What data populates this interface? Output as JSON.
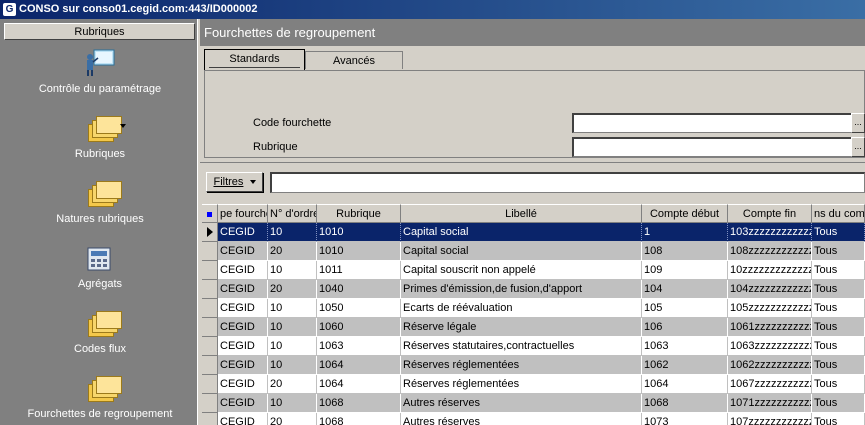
{
  "window": {
    "title": "CONSO sur conso01.cegid.com:443/ID000002",
    "icon": "G"
  },
  "sidebar": {
    "header": "Rubriques",
    "items": [
      {
        "label": "Contrôle du paramétrage",
        "icon": "presentation-board-icon"
      },
      {
        "label": "Rubriques",
        "icon": "folders-icon",
        "has_dropdown": true
      },
      {
        "label": "Natures rubriques",
        "icon": "folders-icon"
      },
      {
        "label": "Agrégats",
        "icon": "calculator-icon"
      },
      {
        "label": "Codes flux",
        "icon": "folders-icon"
      },
      {
        "label": "Fourchettes de regroupement",
        "icon": "folders-icon"
      }
    ]
  },
  "main": {
    "title": "Fourchettes de regroupement",
    "tabs": [
      {
        "label": "Standards",
        "active": true
      },
      {
        "label": "Avancés",
        "active": false
      }
    ],
    "form": {
      "code_label": "Code fourchette",
      "code_value": "",
      "rubrique_label": "Rubrique",
      "rubrique_value": "",
      "ellipsis": "..."
    },
    "filters": {
      "label": "Filtres",
      "value": ""
    },
    "grid": {
      "columns": [
        "pe fourche",
        "N° d'ordre",
        "Rubrique",
        "Libellé",
        "Compte début",
        "Compte fin",
        "ns du com"
      ],
      "rows": [
        [
          "CEGID",
          "10",
          "1010",
          "Capital social",
          "1",
          "103zzzzzzzzzzzzz",
          "Tous"
        ],
        [
          "CEGID",
          "20",
          "1010",
          "Capital social",
          "108",
          "108zzzzzzzzzzzzz",
          "Tous"
        ],
        [
          "CEGID",
          "10",
          "1011",
          "Capital souscrit non appelé",
          "109",
          "10zzzzzzzzzzzzzz",
          "Tous"
        ],
        [
          "CEGID",
          "20",
          "1040",
          "Primes d'émission,de fusion,d'apport",
          "104",
          "104zzzzzzzzzzzzz",
          "Tous"
        ],
        [
          "CEGID",
          "10",
          "1050",
          "Ecarts de réévaluation",
          "105",
          "105zzzzzzzzzzzzz",
          "Tous"
        ],
        [
          "CEGID",
          "10",
          "1060",
          "Réserve légale",
          "106",
          "1061zzzzzzzzzzzz",
          "Tous"
        ],
        [
          "CEGID",
          "10",
          "1063",
          "Réserves statutaires,contractuelles",
          "1063",
          "1063zzzzzzzzzzzz",
          "Tous"
        ],
        [
          "CEGID",
          "10",
          "1064",
          "Réserves réglementées",
          "1062",
          "1062zzzzzzzzzzzz",
          "Tous"
        ],
        [
          "CEGID",
          "20",
          "1064",
          "Réserves réglementées",
          "1064",
          "1067zzzzzzzzzzzz",
          "Tous"
        ],
        [
          "CEGID",
          "10",
          "1068",
          "Autres réserves",
          "1068",
          "1071zzzzzzzzzzzz",
          "Tous"
        ],
        [
          "CEGID",
          "20",
          "1068",
          "Autres réserves",
          "1073",
          "107zzzzzzzzzzzzz",
          "Tous"
        ]
      ]
    }
  }
}
